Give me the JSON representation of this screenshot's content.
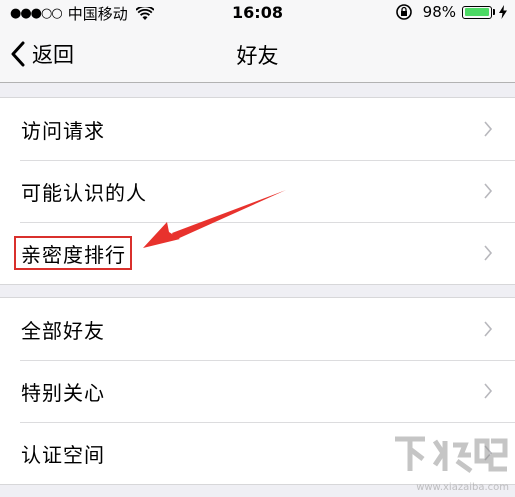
{
  "status_bar": {
    "signal_dots": "●●●○○",
    "carrier": "中国移动",
    "time": "16:08",
    "battery_percent": "98%",
    "battery_level": 0.98,
    "battery_color": "#4cd964"
  },
  "nav": {
    "back_label": "返回",
    "title": "好友"
  },
  "groups": [
    {
      "items": [
        {
          "label": "访问请求"
        },
        {
          "label": "可能认识的人"
        },
        {
          "label": "亲密度排行",
          "highlighted": true
        }
      ]
    },
    {
      "items": [
        {
          "label": "全部好友"
        },
        {
          "label": "特别关心"
        },
        {
          "label": "认证空间"
        }
      ]
    }
  ],
  "annotation": {
    "color": "#e8322d"
  },
  "watermark": {
    "logo": "下载吧",
    "url": "www.xiazaiba.com"
  }
}
